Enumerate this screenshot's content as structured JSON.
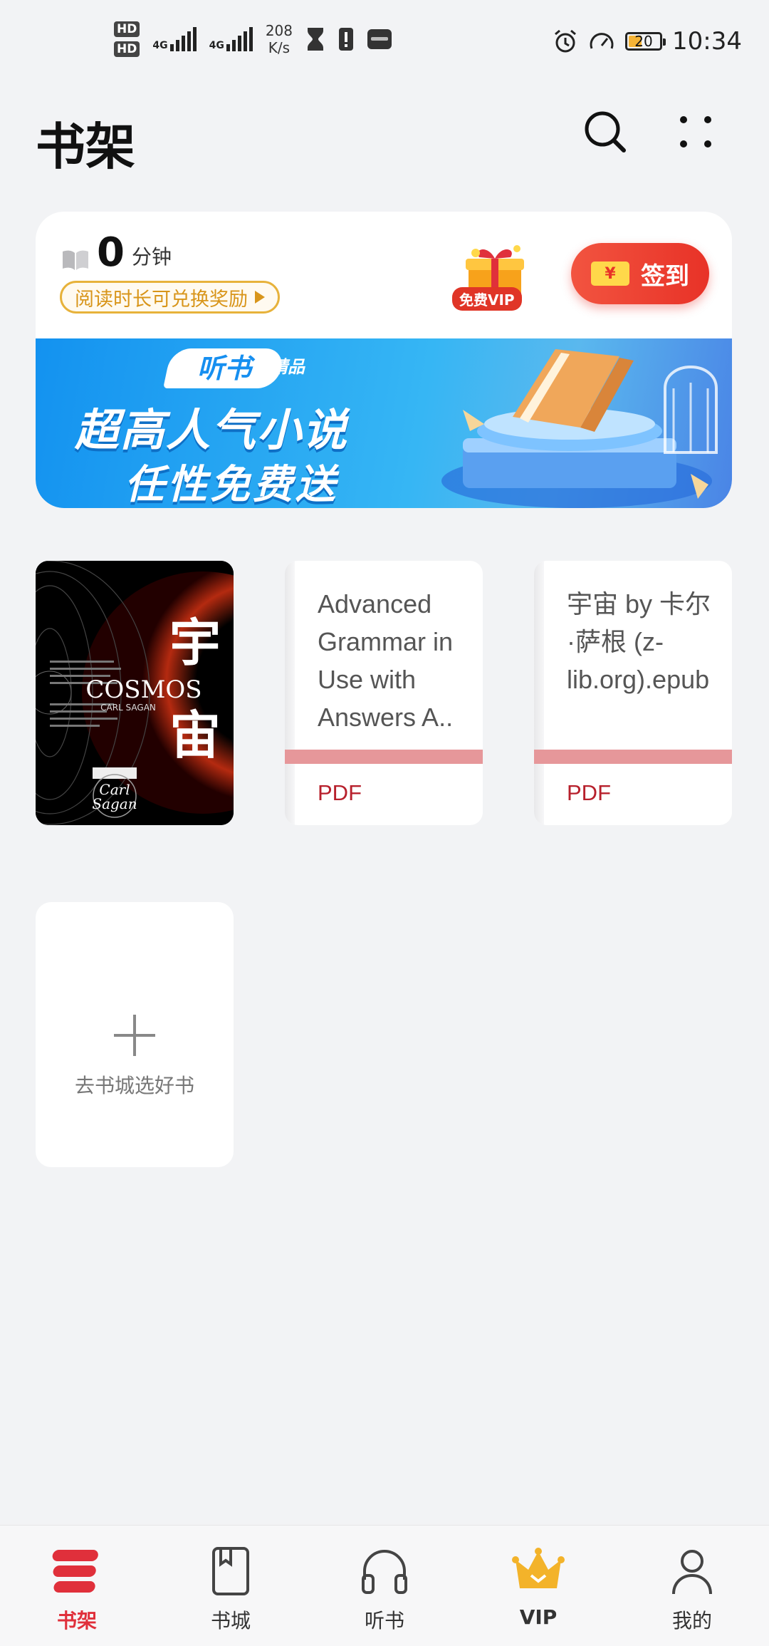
{
  "status_bar": {
    "hd1": "HD",
    "hd2": "HD",
    "sim1_net": "4G",
    "sim2_net": "4G",
    "speed_value": "208",
    "speed_unit": "K/s",
    "battery": "20",
    "time": "10:34"
  },
  "header": {
    "title": "书架"
  },
  "reading": {
    "minutes": "0",
    "unit": "分钟",
    "redeem_text": "阅读时长可兑换奖励",
    "vip_tag": "免费VIP",
    "ticket_symbol": "¥",
    "signin_label": "签到"
  },
  "banner": {
    "tag": "听书",
    "tag_sub": "精品",
    "line1": "超高人气小说",
    "line2": "任性免费送"
  },
  "books": [
    {
      "cover_cn_title_top": "宇",
      "cover_cn_title_bottom": "宙",
      "cover_en_title": "COSMOS",
      "cover_author": "CARL SAGAN",
      "cover_author_script_1": "Carl",
      "cover_author_script_2": "Sagan"
    },
    {
      "title": "Advanced Grammar in Use with Answers A..",
      "format": "PDF"
    },
    {
      "title": "宇宙 by 卡尔·萨根 (z-lib.org).epub",
      "format": "PDF"
    }
  ],
  "add_book": {
    "label": "去书城选好书"
  },
  "nav": [
    {
      "label": "书架",
      "icon": "bookshelf-icon",
      "active": true
    },
    {
      "label": "书城",
      "icon": "book-store-icon"
    },
    {
      "label": "听书",
      "icon": "headphones-icon"
    },
    {
      "label": "VIP",
      "icon": "crown-icon"
    },
    {
      "label": "我的",
      "icon": "profile-icon"
    }
  ],
  "colors": {
    "accent": "#e0303b",
    "gold": "#e7b23b",
    "background": "#f2f3f5"
  }
}
